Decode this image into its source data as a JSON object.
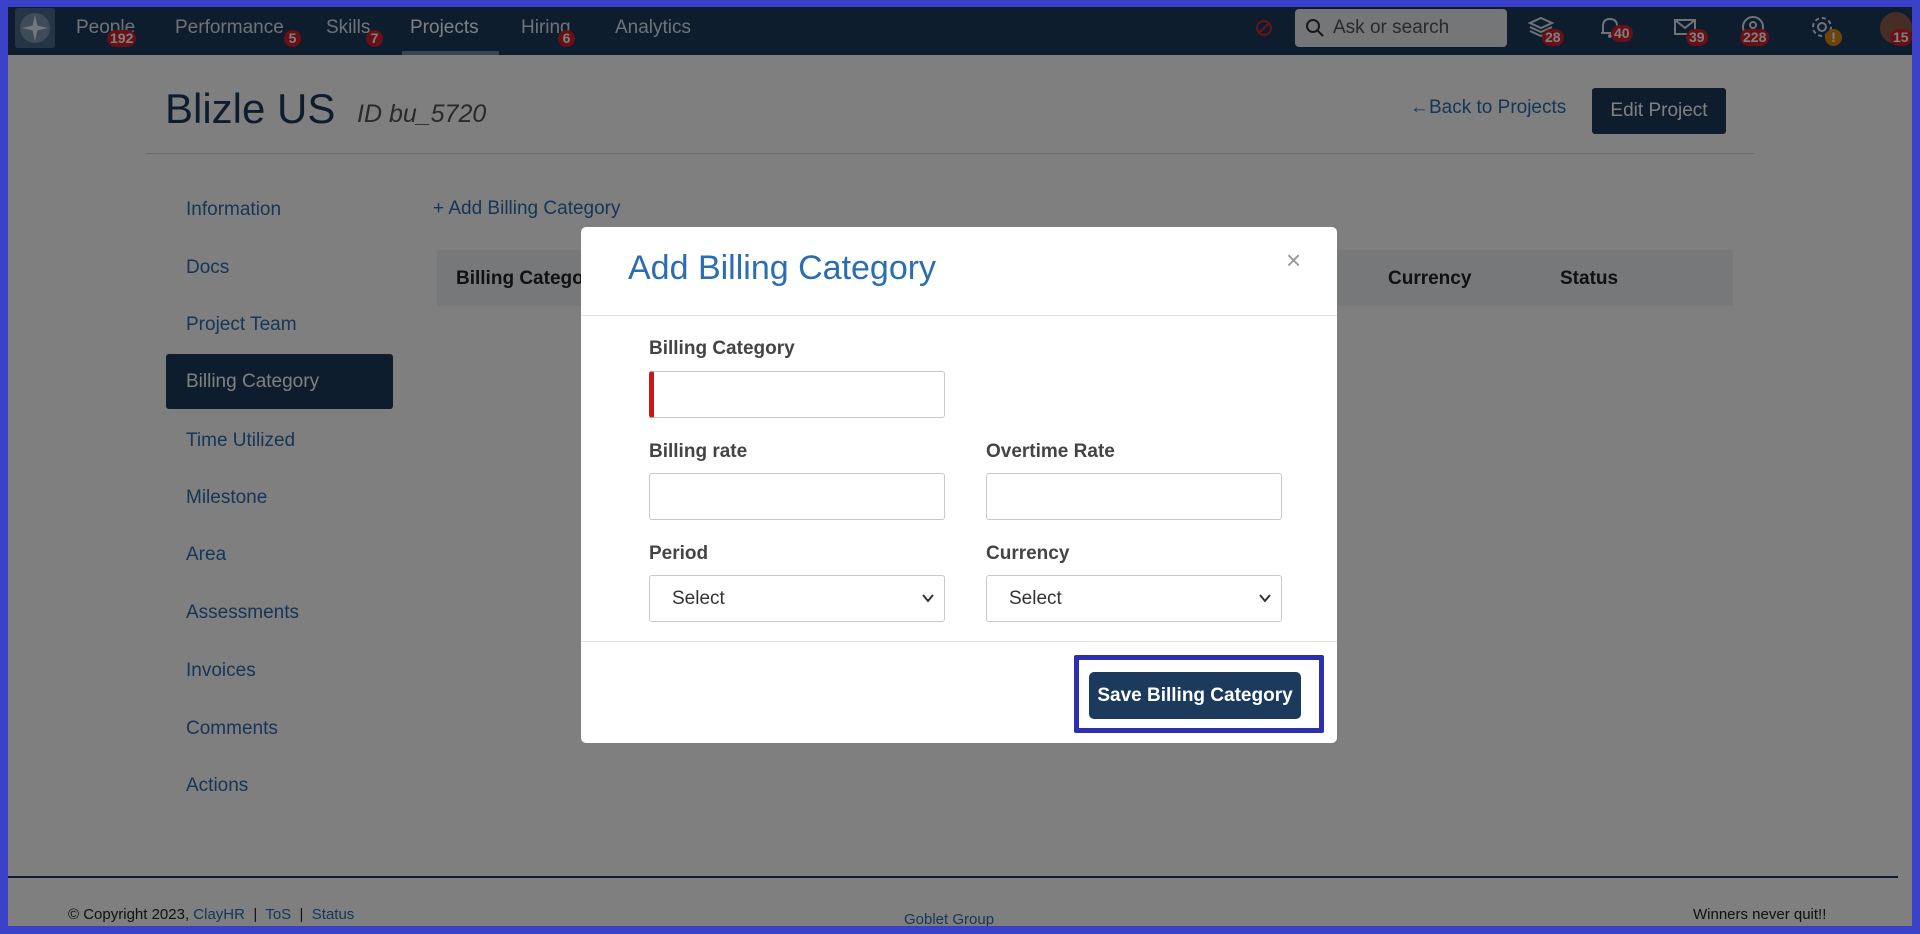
{
  "nav": {
    "items": [
      {
        "label": "People",
        "badge": "192"
      },
      {
        "label": "Performance",
        "badge": "5"
      },
      {
        "label": "Skills",
        "badge": "7"
      },
      {
        "label": "Projects",
        "badge": ""
      },
      {
        "label": "Hiring",
        "badge": "6"
      },
      {
        "label": "Analytics",
        "badge": ""
      }
    ],
    "active": "Projects",
    "search_placeholder": "Ask or search",
    "icon_badges": {
      "layers": "28",
      "bell": "40",
      "mail": "39",
      "support": "228",
      "settings": "!",
      "avatar": "15"
    }
  },
  "page": {
    "title": "Blizle US",
    "id_text": "ID bu_5720",
    "back_link": "Back to Projects",
    "edit_button": "Edit Project"
  },
  "sidebar": {
    "items": [
      {
        "label": "Information"
      },
      {
        "label": "Docs"
      },
      {
        "label": "Project Team"
      },
      {
        "label": "Billing Category"
      },
      {
        "label": "Time Utilized"
      },
      {
        "label": "Milestone"
      },
      {
        "label": "Area"
      },
      {
        "label": "Assessments"
      },
      {
        "label": "Invoices"
      },
      {
        "label": "Comments"
      },
      {
        "label": "Actions"
      }
    ],
    "active": "Billing Category"
  },
  "main": {
    "add_link": "Add Billing Category",
    "table_headers": [
      "Billing Categor",
      "Currency",
      "Status"
    ]
  },
  "modal": {
    "title": "Add Billing Category",
    "close": "×",
    "fields": {
      "billing_category": {
        "label": "Billing Category",
        "value": ""
      },
      "billing_rate": {
        "label": "Billing rate",
        "value": ""
      },
      "overtime_rate": {
        "label": "Overtime Rate",
        "value": ""
      },
      "period": {
        "label": "Period",
        "selected": "Select"
      },
      "currency": {
        "label": "Currency",
        "selected": "Select"
      }
    },
    "save_button": "Save Billing Category"
  },
  "footer": {
    "copyright": "© Copyright 2023,",
    "brand": "ClayHR",
    "sep": "|",
    "tos": "ToS",
    "status": "Status",
    "center": "Goblet Group",
    "motto": "Winners never quit!!"
  },
  "colors": {
    "navy": "#1b3a5c",
    "link": "#2a6db0",
    "badge_red": "#d0202a",
    "badge_orange": "#e0861a",
    "highlight_border": "#2b2fb0"
  }
}
